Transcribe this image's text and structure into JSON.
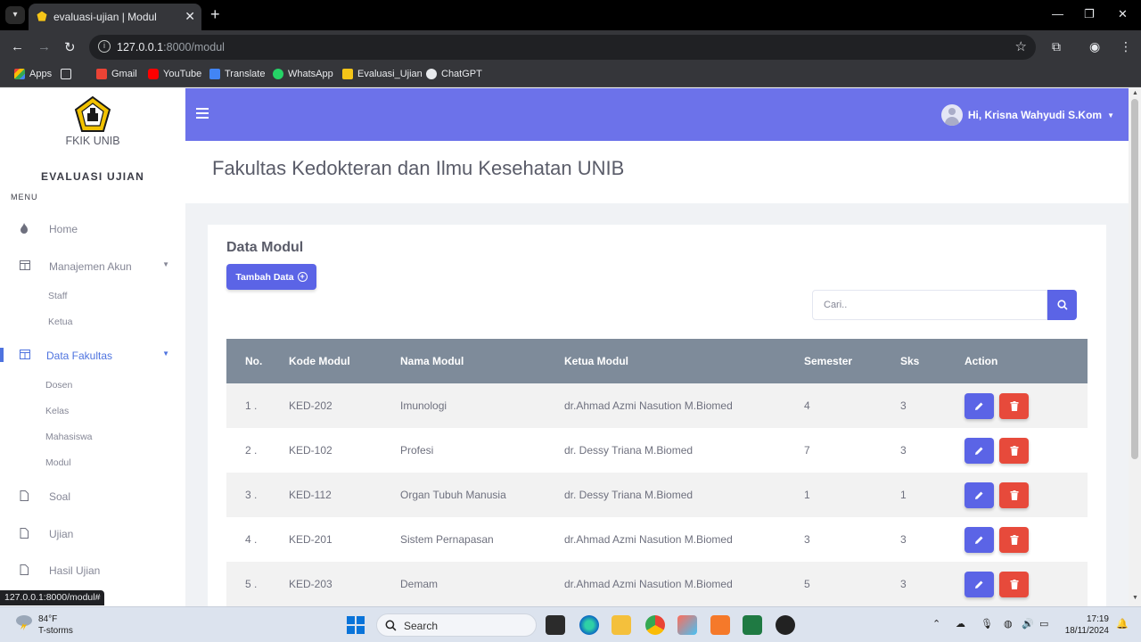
{
  "browser": {
    "tab_title": "evaluasi-ujian | Modul",
    "url_host": "127.0.0.1",
    "url_path": ":8000/modul",
    "bookmarks": [
      "Apps",
      "Gmail",
      "YouTube",
      "Translate",
      "WhatsApp",
      "Evaluasi_Ujian",
      "ChatGPT"
    ],
    "status_url": "127.0.0.1:8000/modul#"
  },
  "sidebar": {
    "brand": "FKIK UNIB",
    "app_name": "EVALUASI UJIAN",
    "menu_label": "MENU",
    "home": "Home",
    "manajemen_akun": "Manajemen Akun",
    "akun_items": [
      "Staff",
      "Ketua"
    ],
    "data_fakultas": "Data Fakultas",
    "fakultas_items": [
      "Dosen",
      "Kelas",
      "Mahasiswa",
      "Modul"
    ],
    "soal": "Soal",
    "ujian": "Ujian",
    "hasil_ujian": "Hasil Ujian"
  },
  "topbar": {
    "user_greeting": "Hi, Krisna Wahyudi S.Kom"
  },
  "header": {
    "title": "Fakultas Kedokteran dan Ilmu Kesehatan UNIB"
  },
  "card": {
    "title": "Data Modul",
    "add_button": "Tambah Data",
    "search_placeholder": "Cari.."
  },
  "table": {
    "headers": [
      "No.",
      "Kode Modul",
      "Nama Modul",
      "Ketua Modul",
      "Semester",
      "Sks",
      "Action"
    ],
    "rows": [
      {
        "no": "1 .",
        "kode": "KED-202",
        "nama": "Imunologi",
        "ketua": "dr.Ahmad Azmi Nasution M.Biomed",
        "semester": "4",
        "sks": "3"
      },
      {
        "no": "2 .",
        "kode": "KED-102",
        "nama": "Profesi",
        "ketua": "dr. Dessy Triana M.Biomed",
        "semester": "7",
        "sks": "3"
      },
      {
        "no": "3 .",
        "kode": "KED-112",
        "nama": "Organ Tubuh Manusia",
        "ketua": "dr. Dessy Triana M.Biomed",
        "semester": "1",
        "sks": "1"
      },
      {
        "no": "4 .",
        "kode": "KED-201",
        "nama": "Sistem Pernapasan",
        "ketua": "dr.Ahmad Azmi Nasution M.Biomed",
        "semester": "3",
        "sks": "3"
      },
      {
        "no": "5 .",
        "kode": "KED-203",
        "nama": "Demam",
        "ketua": "dr.Ahmad Azmi Nasution M.Biomed",
        "semester": "5",
        "sks": "3"
      }
    ]
  },
  "taskbar": {
    "temp": "84°F",
    "weather": "T-storms",
    "search_label": "Search",
    "time": "17:19",
    "date": "18/11/2024"
  },
  "colors": {
    "accent": "#6c72ea",
    "button": "#5b64e6",
    "danger": "#e74a3b",
    "table_header": "#7e8b9a"
  }
}
